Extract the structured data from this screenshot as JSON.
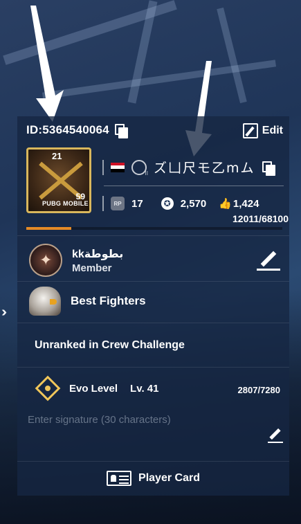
{
  "profile": {
    "id_label": "ID:5364540064",
    "edit_label": "Edit",
    "player_name": "ズ凵尺モ乙mム",
    "flag_colors": [
      "#ce1126",
      "#ffffff",
      "#000000"
    ],
    "avatar": {
      "top_number": "21",
      "tag": "PUBG MOBILE",
      "level": "59"
    }
  },
  "stats": {
    "rp_badge": "RP",
    "rp_value": "17",
    "popularity": "2,570",
    "likes": "1,424",
    "exp": "12011/68100",
    "exp_fraction": 0.176
  },
  "clan": {
    "name": "kkبطوطة",
    "role": "Member"
  },
  "team": {
    "name": "Best Fighters"
  },
  "crew": {
    "status": "Unranked in Crew Challenge"
  },
  "evo": {
    "label": "Evo Level",
    "level": "Lv. 41",
    "progress": "2807/7280"
  },
  "signature": {
    "placeholder": "Enter signature (30 characters)"
  },
  "player_card": {
    "label": "Player Card"
  },
  "icons": [
    "copy-icon",
    "edit-icon",
    "flag-icon",
    "rank-icon",
    "rp-icon",
    "star-icon",
    "thumbs-up-icon",
    "clan-emblem-icon",
    "pencil-icon",
    "eagle-icon",
    "evo-icon",
    "player-card-icon",
    "chevron-right-icon"
  ],
  "colors": {
    "accent": "#e48a26",
    "gold": "#d9b75c",
    "evo": "#f0c65a"
  }
}
